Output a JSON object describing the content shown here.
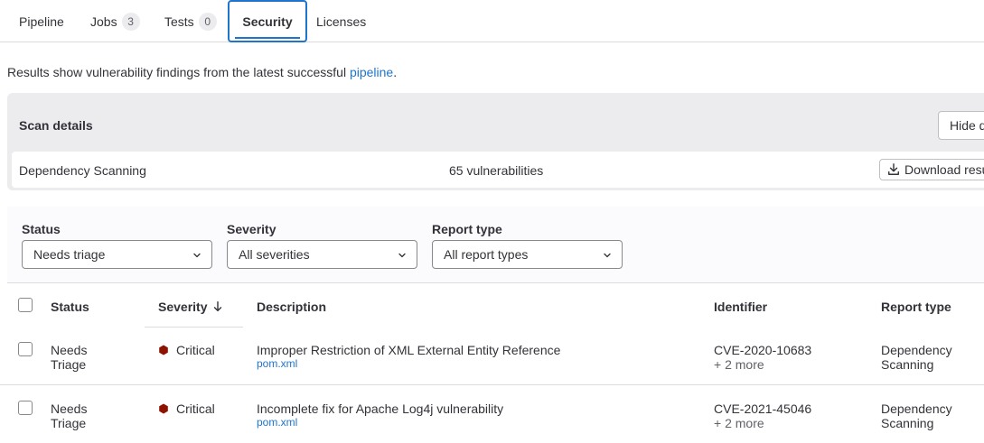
{
  "tabs": {
    "pipeline": "Pipeline",
    "jobs": "Jobs",
    "jobs_count": "3",
    "tests": "Tests",
    "tests_count": "0",
    "security": "Security",
    "licenses": "Licenses"
  },
  "intro": {
    "text": "Results show vulnerability findings from the latest successful ",
    "link": "pipeline",
    "end": "."
  },
  "scan": {
    "title": "Scan details",
    "hide_button": "Hide details",
    "type": "Dependency Scanning",
    "count": "65 vulnerabilities",
    "download_button": "Download results"
  },
  "filters": {
    "status_label": "Status",
    "status_value": "Needs triage",
    "severity_label": "Severity",
    "severity_value": "All severities",
    "report_label": "Report type",
    "report_value": "All report types"
  },
  "table": {
    "headers": {
      "status": "Status",
      "severity": "Severity",
      "description": "Description",
      "identifier": "Identifier",
      "report_type": "Report type"
    },
    "rows": [
      {
        "status_line1": "Needs",
        "status_line2": "Triage",
        "severity": "Critical",
        "description": "Improper Restriction of XML External Entity Reference",
        "file": "pom.xml",
        "identifier": "CVE-2020-10683",
        "more": "+ 2 more",
        "report_line1": "Dependency",
        "report_line2": "Scanning"
      },
      {
        "status_line1": "Needs",
        "status_line2": "Triage",
        "severity": "Critical",
        "description": "Incomplete fix for Apache Log4j vulnerability",
        "file": "pom.xml",
        "identifier": "CVE-2021-45046",
        "more": "+ 2 more",
        "report_line1": "Dependency",
        "report_line2": "Scanning"
      }
    ]
  },
  "colors": {
    "accent": "#1f75cb",
    "critical": "#8d1300"
  }
}
